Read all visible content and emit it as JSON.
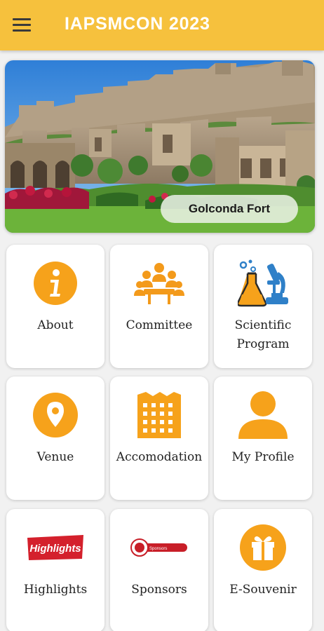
{
  "appbar": {
    "title": "IAPSMCON 2023",
    "menu_icon": "hamburger-menu-icon",
    "background": "#f6c13d"
  },
  "banner": {
    "caption": "Golconda Fort"
  },
  "tiles": [
    {
      "label": "About",
      "icon": "info-icon"
    },
    {
      "label": "Committee",
      "icon": "committee-meeting-icon"
    },
    {
      "label": "Scientific Program",
      "icon": "lab-microscope-icon"
    },
    {
      "label": "Venue",
      "icon": "location-pin-icon"
    },
    {
      "label": "Accomodation",
      "icon": "building-icon"
    },
    {
      "label": "My Profile",
      "icon": "person-icon"
    },
    {
      "label": "Highlights",
      "icon": "highlights-logo-icon",
      "icon_text": "Highlights"
    },
    {
      "label": "Sponsors",
      "icon": "sponsors-logo-icon",
      "icon_text": "Sponsors"
    },
    {
      "label": "E-Souvenir",
      "icon": "gift-icon"
    }
  ],
  "colors": {
    "accent": "#f6a21b",
    "highlight_red": "#d4202c",
    "science_blue": "#2f80c8"
  }
}
